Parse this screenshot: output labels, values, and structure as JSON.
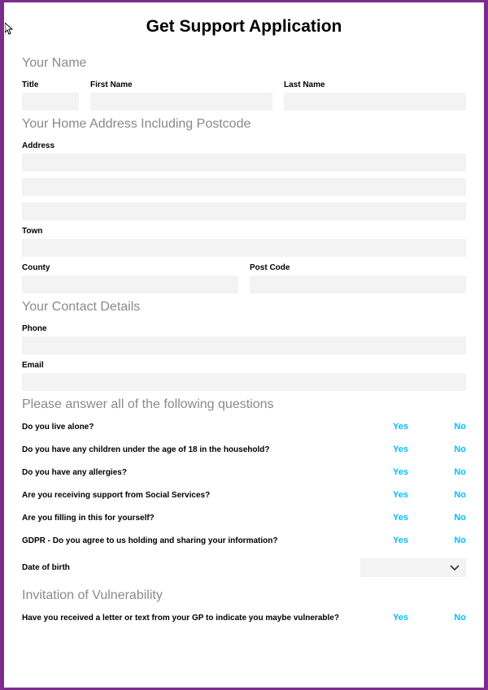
{
  "title": "Get Support Application",
  "sections": {
    "name": {
      "heading": "Your Name",
      "title_label": "Title",
      "first_label": "First Name",
      "last_label": "Last Name",
      "title_value": "",
      "first_value": "",
      "last_value": ""
    },
    "address": {
      "heading": "Your Home Address Including Postcode",
      "address_label": "Address",
      "town_label": "Town",
      "county_label": "County",
      "postcode_label": "Post Code",
      "address_line1": "",
      "address_line2": "",
      "address_line3": "",
      "town_value": "",
      "county_value": "",
      "postcode_value": ""
    },
    "contact": {
      "heading": "Your Contact Details",
      "phone_label": "Phone",
      "email_label": "Email",
      "phone_value": "",
      "email_value": ""
    },
    "questions": {
      "heading": "Please answer all of the following questions",
      "yes": "Yes",
      "no": "No",
      "q1": "Do you live alone?",
      "q2": "Do you have any children under the age of 18 in the household?",
      "q3": "Do you have any allergies?",
      "q4": "Are you receiving support from Social Services?",
      "q5": "Are you filling in this for yourself?",
      "q6": "GDPR - Do you agree to us holding and sharing your information?",
      "dob_label": "Date of birth",
      "dob_value": ""
    },
    "vulnerability": {
      "heading": "Invitation of Vulnerability",
      "q1": "Have you received a letter or text from your GP to indicate you maybe vulnerable?"
    }
  }
}
